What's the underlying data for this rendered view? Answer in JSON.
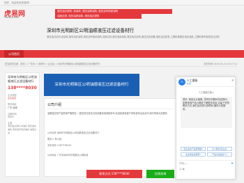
{
  "topbar": {
    "text": "您好，欢迎来到虎易网!"
  },
  "logo": {
    "main": "虎易网",
    "sub": "cooveo.com"
  },
  "keywords": {
    "row1": "液压油过滤机, 滤油机, 液压油滤油机, 液压油专用滤油机",
    "row2": "油液过滤, 液压油滤油机, 液压油过滤机"
  },
  "header": {
    "title": "深圳市光明新区公明油顺液压过滤设备材行",
    "desc": "液压油过滤机,滤油机,液压油滤油机,液压油专用滤油机,油液过滤,液压油滤油机,液压油过滤机,液压过滤设备,液压油过滤机,工程机械液压油滤油机,工程机械专用液压过滤机"
  },
  "nav": {
    "home": "公司首页"
  },
  "breadcrumb": {
    "path": "您当前的位置：首页 > 广东省 > 深圳市 > 企业店 > 深圳市光明新区公明油顺液压过滤设备材行",
    "time": "发布时间 2025-04-15 10:17:12"
  },
  "sidebar": {
    "name": "深圳市光明新区公明油顺液压过滤设备材行",
    "phone": "138****8030",
    "type_label": "企业类型",
    "type_tag": "企业会员",
    "area_label": "所在地区",
    "area": "广东 深圳",
    "year_label": "注册时间",
    "year": "2013",
    "scope_label": "主营",
    "scope": "液压油过滤机,滤油机,液压油滤油机,液压油专用滤油机,油液过滤"
  },
  "banner": {
    "text": "深圳市光明新区公明油顺液压过滤设备材行"
  },
  "main": {
    "section_title": "公司介绍",
    "intro": "油顺液压的产品质量严格把控,一直坚持在液压过滤设备领域深耕多年,欢迎各新老客户来电咨询洽谈合作,我们竭诚为您服务",
    "field1": "公司名称 深圳市光明新区公明油顺液压过滤设备材行",
    "field2": "联系人 林小姐",
    "field3": "手机号码 138****8030",
    "field4": "公司地址 广东省深圳市光明新区公明街道"
  },
  "buttons": {
    "phone": "联系方式 138****8030",
    "chat": "在线咨询"
  },
  "chat": {
    "avatar": "人",
    "agent_name": "人工客服",
    "agent_status": "在线",
    "close": "×",
    "joined": "人工客服已接入",
    "message": "您好, 我是企业客服, 您有任何疑问欢迎提问。如需咨询产品价格或了解更多信息,请留下您的联系方式,我们会尽快与您联系,随时为您服务。",
    "quick1": "该企业的产品有哪些?",
    "quick2": "怎么联系该企业?",
    "quick3": "企业地址在哪里?",
    "quick4": "产品价格是多少?",
    "placeholder": "请输入...",
    "send": "➤",
    "tools": "☺ ▣"
  }
}
